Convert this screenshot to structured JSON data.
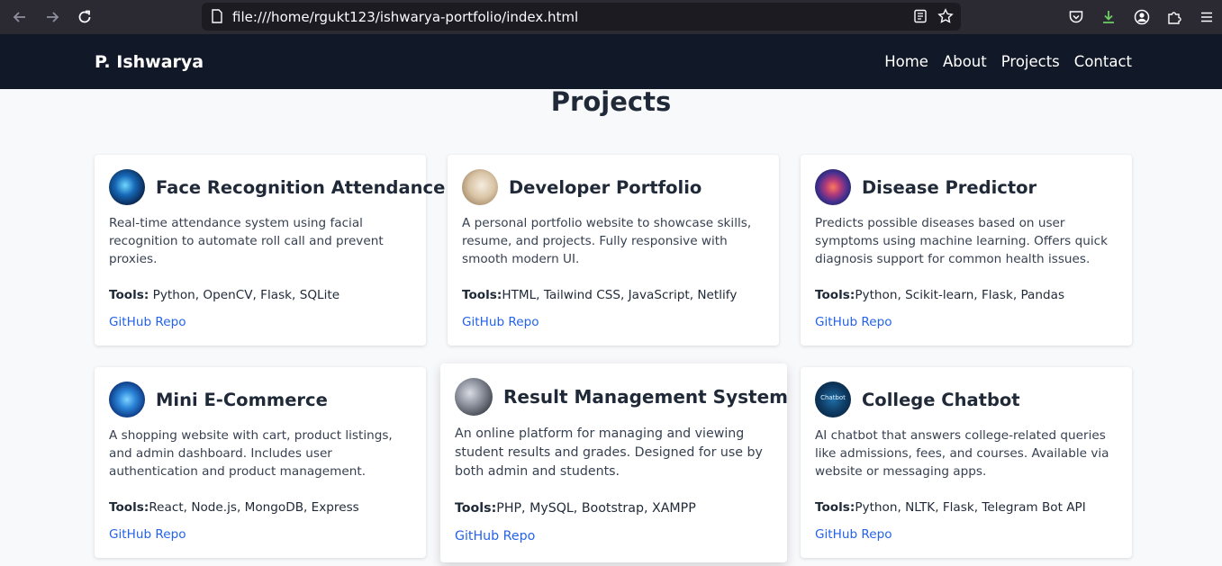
{
  "browser": {
    "url": "file:///home/rgukt123/ishwarya-portfolio/index.html"
  },
  "site": {
    "brand": "P. Ishwarya",
    "nav": [
      "Home",
      "About",
      "Projects",
      "Contact"
    ]
  },
  "section": {
    "title": "Projects"
  },
  "tools_label": "Tools:",
  "projects": [
    {
      "title": "Face Recognition Attendance",
      "description": "Real-time attendance system using facial recognition to automate roll call and prevent proxies.",
      "tools": "Python, OpenCV, Flask, SQLite",
      "link": "GitHub Repo"
    },
    {
      "title": "Developer Portfolio",
      "description": "A personal portfolio website to showcase skills, resume, and projects. Fully responsive with smooth modern UI.",
      "tools": "HTML, Tailwind CSS, JavaScript, Netlify",
      "link": "GitHub Repo"
    },
    {
      "title": "Disease Predictor",
      "description": "Predicts possible diseases based on user symptoms using machine learning. Offers quick diagnosis support for common health issues.",
      "tools": "Python, Scikit-learn, Flask, Pandas",
      "link": "GitHub Repo"
    },
    {
      "title": "Mini E-Commerce",
      "description": "A shopping website with cart, product listings, and admin dashboard. Includes user authentication and product management.",
      "tools": "React, Node.js, MongoDB, Express",
      "link": "GitHub Repo"
    },
    {
      "title": "Result Management System",
      "description": "An online platform for managing and viewing student results and grades. Designed for use by both admin and students.",
      "tools": "PHP, MySQL, Bootstrap, XAMPP",
      "link": "GitHub Repo"
    },
    {
      "title": "College Chatbot",
      "description": "AI chatbot that answers college-related queries like admissions, fees, and courses. Available via website or messaging apps.",
      "tools": "Python, NLTK, Flask, Telegram Bot API",
      "link": "GitHub Repo",
      "thumb_text": "Chatbot"
    }
  ]
}
